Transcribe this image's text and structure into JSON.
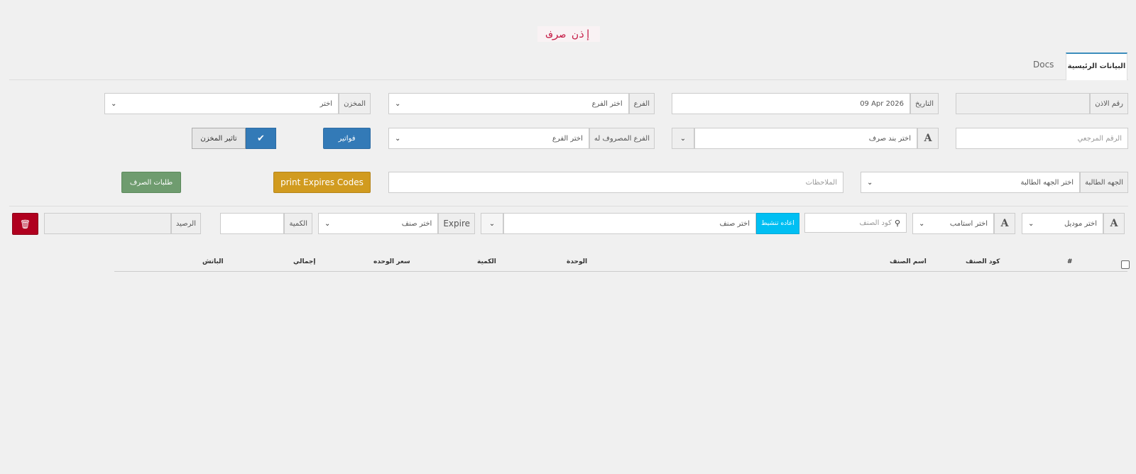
{
  "page": {
    "title": "إذن صرف"
  },
  "tabs": [
    {
      "label": "البيانات الرئيسية"
    },
    {
      "label": "Docs"
    }
  ],
  "form": {
    "permit_no_label": "رقم الاذن",
    "date_label": "التاريخ",
    "date_value": "09 Apr 2026",
    "branch_label": "الفرع",
    "branch_value": "اختر الفرع",
    "store_label": "المخزن",
    "store_value": "اختر",
    "ref_no_placeholder": "الرقم المرجعي",
    "expense_item_value": "اختر بند صرف",
    "target_branch_label": "الفرع المصروف له",
    "target_branch_value": "اختر الفرع",
    "invoices_button": "فواتير",
    "store_effect_label": "تاثير المخزن",
    "requesting_party_label": "الجهه الطالبة",
    "requesting_party_value": "اختر الجهه الطالبة",
    "notes_placeholder": "الملاحظات",
    "print_expires_button": "print Expires Codes",
    "dispense_requests_button": "طلبات الصرف"
  },
  "item_row": {
    "model_value": "اختر موديل",
    "stamp_value": "اختر استامب",
    "item_code_placeholder": "كود الصنف",
    "reactivate_button": "اعاده تنشيط",
    "item_value": "اختر صنف",
    "expire_label": "Expire",
    "expire_value": "اختر صنف",
    "quantity_label": "الكمية",
    "balance_label": "الرصيد"
  },
  "table": {
    "columns": [
      "#",
      "كود الصنف",
      "اسم الصنف",
      "الوحدة",
      "الكمية",
      "سعر الوحده",
      "إجمالي",
      "الباتش"
    ]
  },
  "colors": {
    "primary": "#337ab7",
    "warning": "#d19b1f",
    "success": "#6f9c6f",
    "danger": "#b0001f",
    "info": "#00bff3",
    "title": "#c7254e"
  },
  "icons": {
    "search": "search-icon",
    "check": "check-icon",
    "trash": "trash-icon",
    "chevron": "chevron-down-icon",
    "letter": "font-icon"
  }
}
